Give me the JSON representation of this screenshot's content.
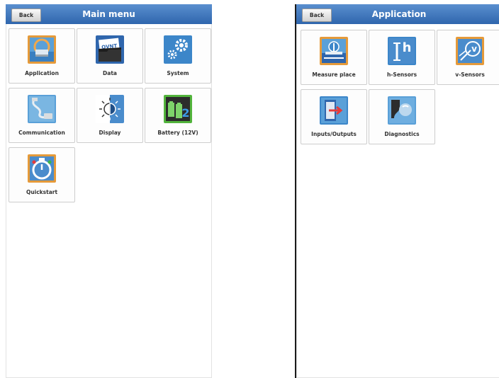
{
  "main_menu": {
    "title": "Main menu",
    "back_label": "Back",
    "tiles": [
      {
        "label": "Application"
      },
      {
        "label": "Data"
      },
      {
        "label": "System"
      },
      {
        "label": "Communication"
      },
      {
        "label": "Display"
      },
      {
        "label": "Battery (12V)"
      },
      {
        "label": "Quickstart"
      }
    ],
    "data_icon_text": "QVNT",
    "battery_icon_text": "2"
  },
  "application_menu": {
    "title": "Application",
    "back_label": "Back",
    "tiles": [
      {
        "label": "Measure place"
      },
      {
        "label": "h-Sensors"
      },
      {
        "label": "v-Sensors"
      },
      {
        "label": "Inputs/Outputs"
      },
      {
        "label": "Diagnostics"
      }
    ],
    "h_icon_text": "h",
    "v_icon_text": "v"
  },
  "colors": {
    "title_bar": "#2f66ad",
    "icon_frame_orange": "#e59a3a",
    "icon_frame_green": "#52b43c",
    "icon_blue": "#2d6fb4"
  }
}
